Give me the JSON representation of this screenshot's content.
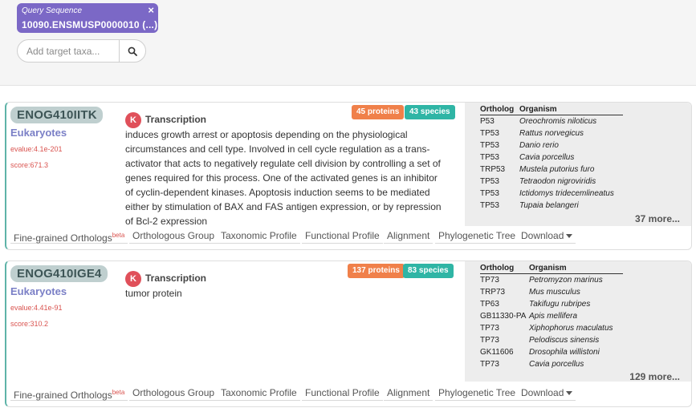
{
  "query": {
    "label": "Query Sequence",
    "value": "10090.ENSMUSP0000010 (...)",
    "close_icon": "×"
  },
  "search": {
    "placeholder": "Add target taxa..."
  },
  "colors": {
    "query_tag": "#7b68c6",
    "proteins_badge": "#f0804a",
    "species_badge": "#2fb5a5",
    "category_circle": "#e0505a",
    "level_text": "#7a7fc6",
    "score_text": "#d9534f"
  },
  "results": [
    {
      "og_name": "ENOG410IITK",
      "level": "Eukaryotes",
      "evalue": "evalue:4.1e-201",
      "score": "score:671.3",
      "proteins_badge": "45 proteins",
      "species_badge": "43 species",
      "category_letter": "K",
      "category": "Transcription",
      "description": "induces growth arrest or apoptosis depending on the physiological circumstances and cell type. Involved in cell cycle regulation as a trans-activator that acts to negatively regulate cell division by controlling a set of genes required for this process. One of the activated genes is an inhibitor of cyclin-dependent kinases. Apoptosis induction seems to be mediated either by stimulation of BAX and FAS antigen expression, or by repression of Bcl-2 expression",
      "ortholog_header": "Ortholog",
      "organism_header": "Organism",
      "orthologs": [
        {
          "gene": "P53",
          "organism": "Oreochromis niloticus"
        },
        {
          "gene": "TP53",
          "organism": "Rattus norvegicus"
        },
        {
          "gene": "TP53",
          "organism": "Danio rerio"
        },
        {
          "gene": "TP53",
          "organism": "Cavia porcellus"
        },
        {
          "gene": "TRP53",
          "organism": "Mustela putorius furo"
        },
        {
          "gene": "TP53",
          "organism": "Tetraodon nigroviridis"
        },
        {
          "gene": "TP53",
          "organism": "Ictidomys tridecemlineatus"
        },
        {
          "gene": "TP53",
          "organism": "Tupaia belangeri"
        }
      ],
      "more": "37 more..."
    },
    {
      "og_name": "ENOG410IGE4",
      "level": "Eukaryotes",
      "evalue": "evalue:4.41e-91",
      "score": "score:310.2",
      "proteins_badge": "137 proteins",
      "species_badge": "83 species",
      "category_letter": "K",
      "category": "Transcription",
      "description": "tumor protein",
      "ortholog_header": "Ortholog",
      "organism_header": "Organism",
      "orthologs": [
        {
          "gene": "TP73",
          "organism": "Petromyzon marinus"
        },
        {
          "gene": "TRP73",
          "organism": "Mus musculus"
        },
        {
          "gene": "TP63",
          "organism": "Takifugu rubripes"
        },
        {
          "gene": "GB11330-PA",
          "organism": "Apis mellifera"
        },
        {
          "gene": "TP73",
          "organism": "Xiphophorus maculatus"
        },
        {
          "gene": "TP73",
          "organism": "Pelodiscus sinensis"
        },
        {
          "gene": "GK11606",
          "organism": "Drosophila willistoni"
        },
        {
          "gene": "TP73",
          "organism": "Cavia porcellus"
        }
      ],
      "more": "129 more..."
    }
  ],
  "tabs": {
    "fine_grained": "Fine-grained Orthologs",
    "beta": "beta",
    "orthologous_group": "Orthologous Group",
    "taxonomic_profile": "Taxonomic Profile",
    "functional_profile": "Functional Profile",
    "alignment": "Alignment",
    "phylogenetic_tree": "Phylogenetic Tree",
    "download": "Download"
  }
}
